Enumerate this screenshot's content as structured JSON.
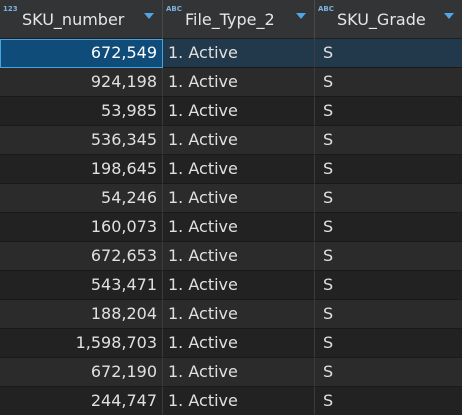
{
  "columns": [
    {
      "name": "SKU_number",
      "type_icon": "123",
      "type_icon_name": "numeric-type-icon",
      "sort_icon": "sort-dropdown-icon"
    },
    {
      "name": "File_Type_2",
      "type_icon": "ABC",
      "type_icon_name": "text-type-icon",
      "sort_icon": "sort-dropdown-icon"
    },
    {
      "name": "SKU_Grade",
      "type_icon": "ABC",
      "type_icon_name": "text-type-icon",
      "sort_icon": "sort-dropdown-icon"
    }
  ],
  "rows": [
    {
      "sku_number": "672,549",
      "file_type_2": "1. Active",
      "sku_grade": "S",
      "selected": true
    },
    {
      "sku_number": "924,198",
      "file_type_2": "1. Active",
      "sku_grade": "S"
    },
    {
      "sku_number": "53,985",
      "file_type_2": "1. Active",
      "sku_grade": "S"
    },
    {
      "sku_number": "536,345",
      "file_type_2": "1. Active",
      "sku_grade": "S"
    },
    {
      "sku_number": "198,645",
      "file_type_2": "1. Active",
      "sku_grade": "S"
    },
    {
      "sku_number": "54,246",
      "file_type_2": "1. Active",
      "sku_grade": "S"
    },
    {
      "sku_number": "160,073",
      "file_type_2": "1. Active",
      "sku_grade": "S"
    },
    {
      "sku_number": "672,653",
      "file_type_2": "1. Active",
      "sku_grade": "S"
    },
    {
      "sku_number": "543,471",
      "file_type_2": "1. Active",
      "sku_grade": "S"
    },
    {
      "sku_number": "188,204",
      "file_type_2": "1. Active",
      "sku_grade": "S"
    },
    {
      "sku_number": "1,598,703",
      "file_type_2": "1. Active",
      "sku_grade": "S"
    },
    {
      "sku_number": "672,190",
      "file_type_2": "1. Active",
      "sku_grade": "S"
    },
    {
      "sku_number": "244,747",
      "file_type_2": "1. Active",
      "sku_grade": "S"
    }
  ],
  "colors": {
    "header_bg": "#333436",
    "row_even": "#222222",
    "row_odd": "#2b2b2b",
    "selection": "#0f4c7a",
    "accent": "#4ea6e6",
    "text": "#e0e0e0"
  }
}
